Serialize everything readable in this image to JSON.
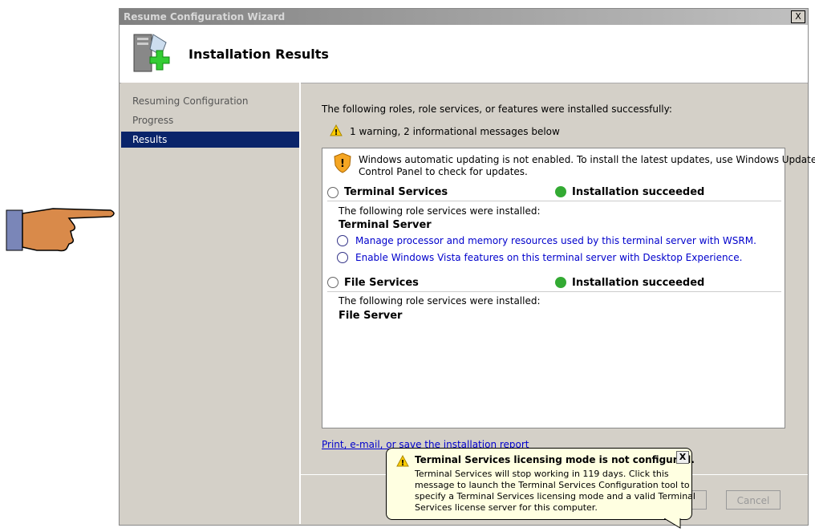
{
  "window": {
    "title": "Resume Configuration Wizard",
    "close": "X"
  },
  "header": {
    "title": "Installation Results"
  },
  "nav": {
    "items": [
      {
        "label": "Resuming Configuration"
      },
      {
        "label": "Progress"
      },
      {
        "label": "Results"
      }
    ]
  },
  "main": {
    "intro": "The following roles, role services, or features were installed successfully:",
    "summary": "1 warning, 2 informational messages below",
    "warning_line1": "Windows automatic updating is not enabled. To install the latest updates, use Windows Update in",
    "warning_line2": "Control Panel to check for updates.",
    "sections": [
      {
        "name": "Terminal Services",
        "status": "Installation succeeded",
        "note": "The following role services were installed:",
        "service": "Terminal Server",
        "links": [
          "Manage processor and memory resources used by this terminal server with WSRM.",
          "Enable Windows Vista features on this terminal server with Desktop Experience."
        ]
      },
      {
        "name": "File Services",
        "status": "Installation succeeded",
        "note": "The following role services were installed:",
        "service": "File Server"
      }
    ],
    "report_link": "Print, e-mail, or save the installation report"
  },
  "buttons": {
    "cancel": "Cancel"
  },
  "balloon": {
    "title": "Terminal Services licensing mode is not configured.",
    "close": "X",
    "lines": [
      "Terminal Services will stop working in 119 days. Click this",
      "message to launch the Terminal Services Configuration tool to",
      "specify a Terminal Services licensing mode and a valid Terminal",
      "Services license server for this computer."
    ]
  }
}
